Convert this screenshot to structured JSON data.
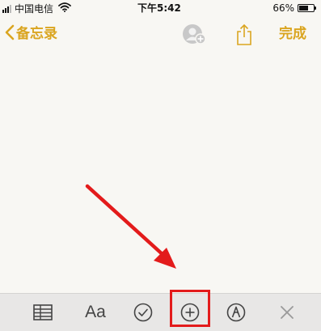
{
  "status_bar": {
    "carrier": "中国电信",
    "time": "下午5:42",
    "battery_percent": "66%",
    "battery_level": 0.66
  },
  "nav": {
    "back_label": "备忘录",
    "done_label": "完成",
    "accent_color": "#daa520"
  },
  "toolbar": {
    "format_label": "Aa",
    "items": [
      "table-icon",
      "format-text-button",
      "checklist-icon",
      "add-icon",
      "markup-icon",
      "close-icon"
    ],
    "highlighted_item": "add-icon"
  },
  "annotation": {
    "color": "#e31b1b"
  }
}
